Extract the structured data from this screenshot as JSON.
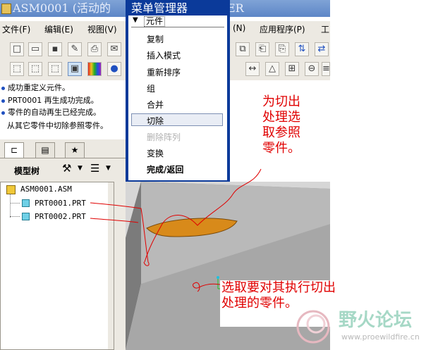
{
  "window": {
    "title": "ASM0001 (活动的",
    "title_tail": "ER"
  },
  "menubar": [
    {
      "label": "文件(F)"
    },
    {
      "label": "编辑(E)"
    },
    {
      "label": "视图(V)"
    },
    {
      "label": "(N)"
    },
    {
      "label": "应用程序(P)"
    },
    {
      "label": "工"
    }
  ],
  "messages": [
    {
      "text": "成功重定义元件。",
      "bullet": true
    },
    {
      "text": "PRT0001 再生成功完成。",
      "bullet": true
    },
    {
      "text": "零件的自动再生已经完成。",
      "bullet": true
    },
    {
      "text": "从其它零件中切除参照零件。",
      "bullet": false
    }
  ],
  "left_panel": {
    "model_tree_label": "模型树",
    "tree": [
      {
        "label": "ASM0001.ASM",
        "type": "assembly"
      },
      {
        "label": "PRT0001.PRT",
        "type": "part"
      },
      {
        "label": "PRT0002.PRT",
        "type": "part"
      }
    ]
  },
  "menu_manager": {
    "title": "菜单管理器",
    "header": "元件",
    "items": [
      {
        "label": "复制",
        "enabled": true
      },
      {
        "label": "插入模式",
        "enabled": true
      },
      {
        "label": "重新排序",
        "enabled": true
      },
      {
        "label": "组",
        "enabled": true
      },
      {
        "label": "合并",
        "enabled": true
      },
      {
        "label": "切除",
        "enabled": true,
        "selected": true
      },
      {
        "label": "删除阵列",
        "enabled": false
      },
      {
        "label": "变换",
        "enabled": true
      },
      {
        "label": "完成/返回",
        "enabled": true,
        "bold": true
      }
    ]
  },
  "annotations": {
    "top": [
      "为切出",
      "处理选",
      "取参照",
      "零件。"
    ],
    "bottom": [
      "选取要对其执行切出",
      "处理的零件。"
    ]
  },
  "watermark": {
    "text": "野火论坛",
    "url": "www.proewildfire.cn"
  },
  "colors": {
    "annotation": "#e00000",
    "menu_blue": "#0b3a9a",
    "part_orange": "#d88a1a"
  }
}
